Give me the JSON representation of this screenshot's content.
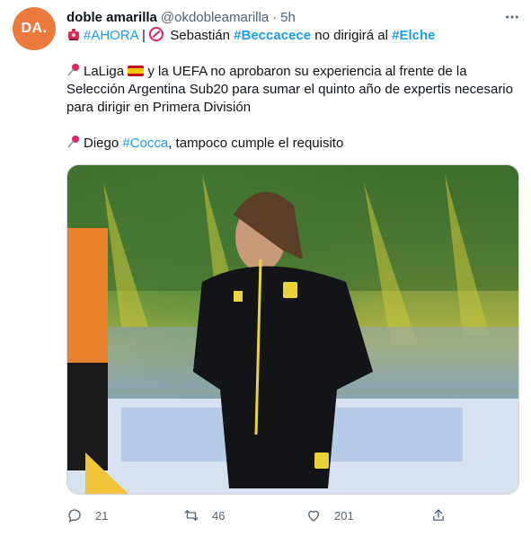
{
  "author": {
    "avatar_text": "DA.",
    "display_name": "doble amarilla",
    "handle": "@okdobleamarilla",
    "separator": "·",
    "time": "5h"
  },
  "content": {
    "line1": {
      "ahora": "#AHORA",
      "sep": " | ",
      "text_a": " Sebastián ",
      "beccacece": "#Beccacece",
      "text_b": " no dirigirá al ",
      "elche": "#Elche"
    },
    "para2": {
      "laliga": "LaLiga",
      "text": " y la UEFA no aprobaron su experiencia al frente de la Selección Argentina Sub20 para sumar el quinto año de expertis necesario para dirigir en Primera División"
    },
    "para3": {
      "diego": "Diego ",
      "cocca": "#Cocca",
      "text": ", tampoco cumple el requisito"
    }
  },
  "media": {
    "description_icon": "photo"
  },
  "actions": {
    "reply_count": "21",
    "retweet_count": "46",
    "like_count": "201"
  },
  "colors": {
    "link": "#1d9bf0",
    "muted": "#536471",
    "avatar_bg": "#ec7a3e"
  }
}
